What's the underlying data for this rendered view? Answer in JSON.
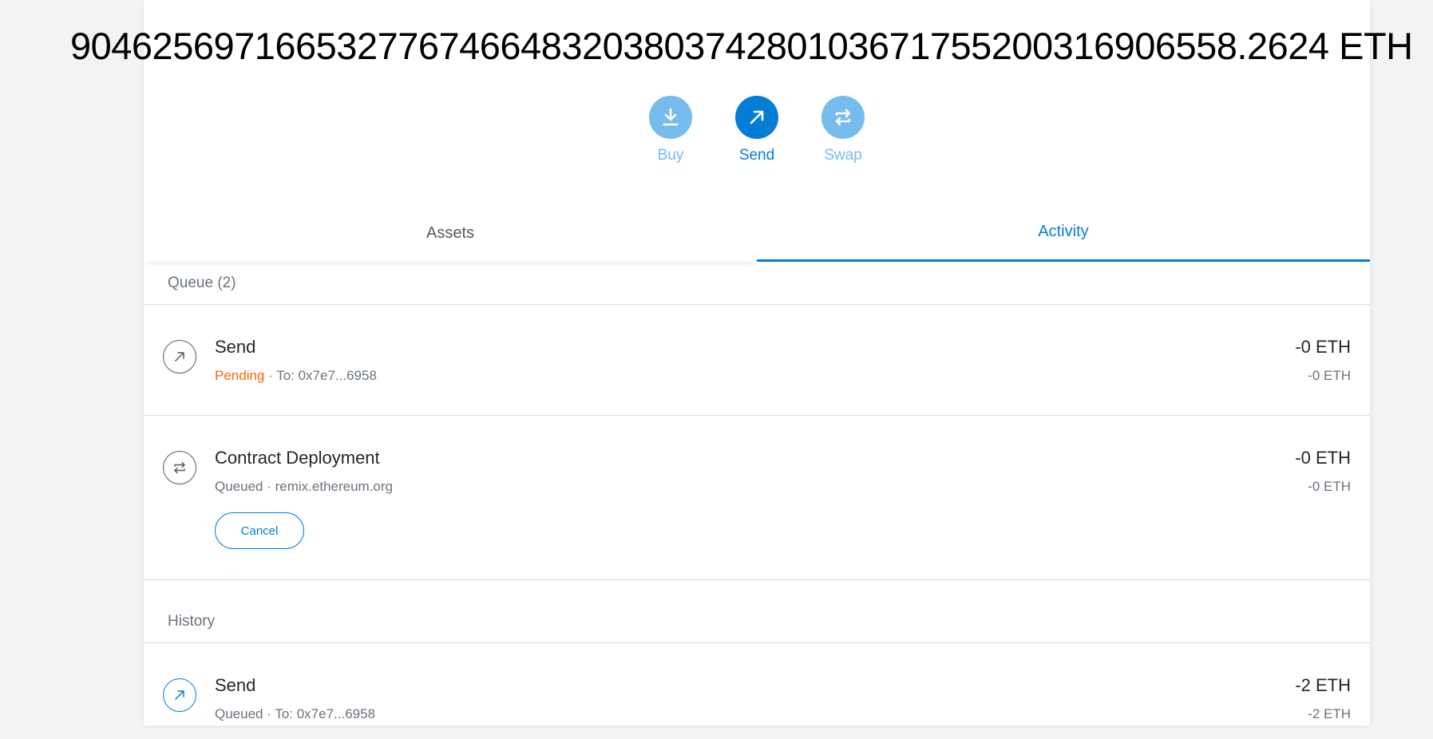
{
  "balance": {
    "value": "9046256971665327767466483203803742801036717552003169065 58.2624",
    "currency": "ETH",
    "display": "904625697166532776746648320380374280103671755200316906558.2624 ETH"
  },
  "actions": {
    "buy": {
      "label": "Buy",
      "color": "#77bcee"
    },
    "send": {
      "label": "Send",
      "color": "#037dd6"
    },
    "swap": {
      "label": "Swap",
      "color": "#77bcee"
    }
  },
  "tabs": {
    "assets": "Assets",
    "activity": "Activity"
  },
  "queue": {
    "heading": "Queue (2)",
    "items": [
      {
        "title": "Send",
        "status": "Pending",
        "detail": "To: 0x7e7...6958",
        "amount": "-0 ETH",
        "amount_secondary": "-0 ETH"
      },
      {
        "title": "Contract Deployment",
        "status": "Queued",
        "detail": "remix.ethereum.org",
        "amount": "-0 ETH",
        "amount_secondary": "-0 ETH",
        "cancel_label": "Cancel"
      }
    ]
  },
  "history": {
    "heading": "History",
    "items": [
      {
        "title": "Send",
        "status": "Queued",
        "detail": "To: 0x7e7...6958",
        "amount": "-2 ETH",
        "amount_secondary": "-2 ETH"
      }
    ]
  },
  "separator": " · ",
  "colors": {
    "accent": "#037dd6",
    "pending": "#f66a0a",
    "muted": "#6a737d"
  }
}
